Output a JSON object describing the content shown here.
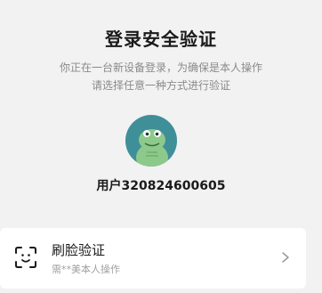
{
  "header": {
    "title": "登录安全验证",
    "subtitle_line1": "你正在一台新设备登录，为确保是本人操作",
    "subtitle_line2": "请选择任意一种方式进行验证"
  },
  "user": {
    "avatar_icon": "cartoon-avatar-icon",
    "username": "用户320824600605"
  },
  "verification_options": [
    {
      "icon": "face-scan-icon",
      "label": "刷脸验证",
      "description": "需**美本人操作",
      "chevron_icon": "chevron-right-icon"
    }
  ],
  "colors": {
    "background": "#f2f2f2",
    "card": "#ffffff",
    "avatar_bg": "#3f8f99",
    "avatar_figure": "#8dc98a",
    "text_primary": "#1a1a1a",
    "text_secondary": "#8a8a8a"
  }
}
